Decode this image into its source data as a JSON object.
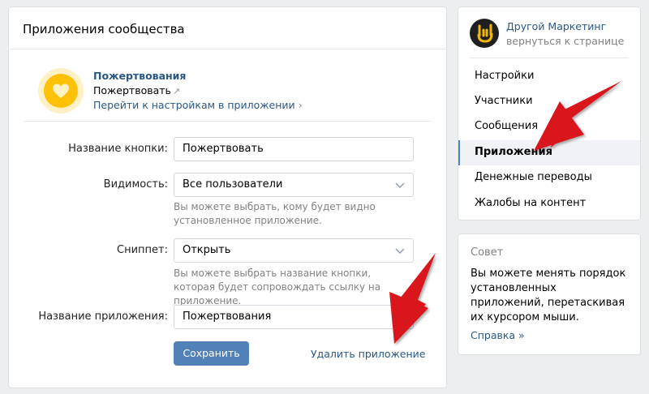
{
  "main": {
    "title": "Приложения сообщества",
    "app": {
      "title": "Пожертвования",
      "action": "Пожертвовать",
      "action_ext_icon": "↗",
      "settings_link": "Перейти к настройкам в приложении",
      "settings_chevron": "›",
      "logo_icon": "heart-icon"
    },
    "form": {
      "button_name": {
        "label": "Название кнопки:",
        "value": "Пожертвовать"
      },
      "visibility": {
        "label": "Видимость:",
        "value": "Все пользователи",
        "hint": "Вы можете выбрать, кому будет видно установленное приложение."
      },
      "snippet": {
        "label": "Сниппет:",
        "value": "Открыть",
        "hint": "Вы можете выбрать название кнопки, которая будет сопровождать ссылку на приложение."
      },
      "app_name": {
        "label": "Название приложения:",
        "value": "Пожертвования"
      }
    },
    "save_label": "Сохранить",
    "delete_label": "Удалить приложение"
  },
  "sidebar": {
    "group_name": "Другой Маркетинг",
    "back_link": "вернуться к странице",
    "items": [
      {
        "label": "Настройки",
        "active": false
      },
      {
        "label": "Участники",
        "active": false
      },
      {
        "label": "Сообщения",
        "active": false
      },
      {
        "label": "Приложения",
        "active": true
      },
      {
        "label": "Денежные переводы",
        "active": false
      },
      {
        "label": "Жалобы на контент",
        "active": false
      }
    ]
  },
  "tip": {
    "title": "Совет",
    "text": "Вы можете менять порядок установленных приложений, перетаскивая их курсором мыши.",
    "link": "Справка »"
  },
  "colors": {
    "accent": "#5181b8",
    "link": "#2a5885",
    "annotation_arrow": "#d8141a",
    "logo_yellow": "#ffc107"
  }
}
